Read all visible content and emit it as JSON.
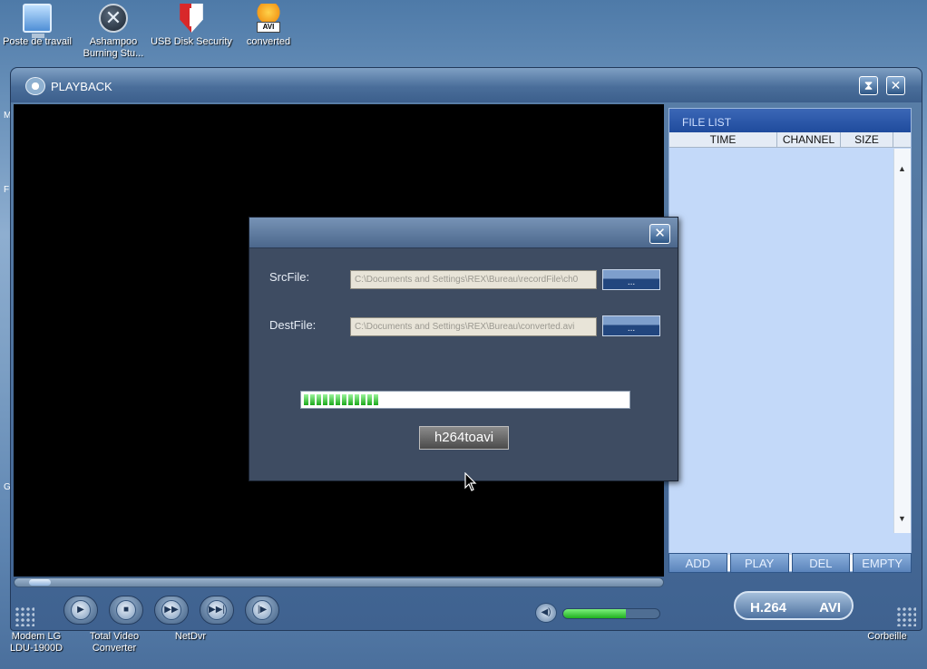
{
  "desktop": {
    "icons": [
      {
        "label": "Poste de travail",
        "icon": "computer-icon"
      },
      {
        "label": "Ashampoo Burning Stu...",
        "icon": "ashampoo-icon"
      },
      {
        "label": "USB Disk Security",
        "icon": "shield-icon"
      },
      {
        "label": "converted",
        "icon": "avi-file-icon",
        "badge": "AVI"
      }
    ],
    "bottom_labels": {
      "modem": "Modem LG LDU-1900D",
      "total_video": "Total Video Converter",
      "netdvr": "NetDvr",
      "corbeille": "Corbeille"
    },
    "edge_letters": [
      "M",
      "F",
      "G"
    ]
  },
  "window": {
    "title": "PLAYBACK",
    "minimize_glyph": "⧗",
    "close_glyph": "✕"
  },
  "file_list": {
    "title": "FILE LIST",
    "columns": [
      "TIME",
      "CHANNEL",
      "SIZE"
    ],
    "buttons": [
      "ADD",
      "PLAY",
      "DEL",
      "EMPTY"
    ]
  },
  "controls": {
    "buttons": [
      {
        "name": "play-button",
        "glyph": "▶"
      },
      {
        "name": "stop-button",
        "glyph": "■"
      },
      {
        "name": "fast-forward-button",
        "glyph": "▶▶"
      },
      {
        "name": "next-button",
        "glyph": "▶▶|"
      },
      {
        "name": "step-button",
        "glyph": "|▶"
      }
    ],
    "volume_level": 0.65,
    "seek_position": 0.02,
    "converter_left": "H.264",
    "converter_right": "AVI"
  },
  "dialog": {
    "close_glyph": "✕",
    "src_label": "SrcFile:",
    "src_value": "C:\\Documents and Settings\\REX\\Bureau\\recordFile\\ch0",
    "dest_label": "DestFile:",
    "dest_value": "C:\\Documents and Settings\\REX\\Bureau\\converted.avi",
    "browse_label": "...",
    "progress": 0.24,
    "convert_button": "h264toavi"
  },
  "colors": {
    "accent": "#1f4b9d",
    "progress_green": "#1ba91b",
    "video_bg": "#000000"
  }
}
